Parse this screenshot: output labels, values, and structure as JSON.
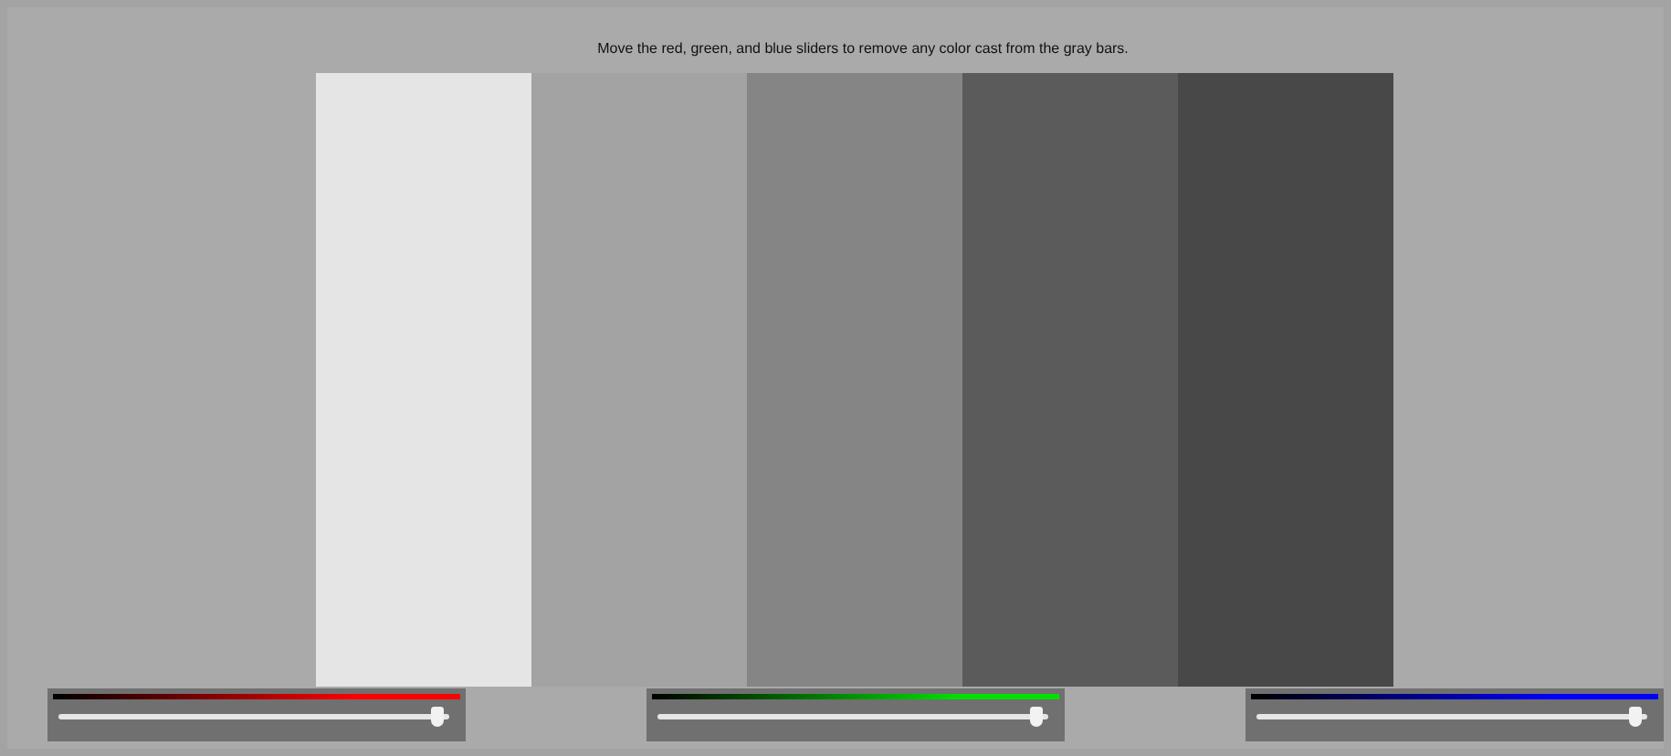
{
  "instruction": "Move the red, green, and blue sliders to remove any color cast from the gray bars.",
  "gray_bars": [
    {
      "color": "#e5e5e5"
    },
    {
      "color": "#a3a3a3"
    },
    {
      "color": "#858585"
    },
    {
      "color": "#5b5b5b"
    },
    {
      "color": "#484848"
    }
  ],
  "sliders": [
    {
      "color": "#ff0000",
      "level": 0.97
    },
    {
      "color": "#00e000",
      "level": 0.97
    },
    {
      "color": "#0000ff",
      "level": 0.97
    }
  ]
}
